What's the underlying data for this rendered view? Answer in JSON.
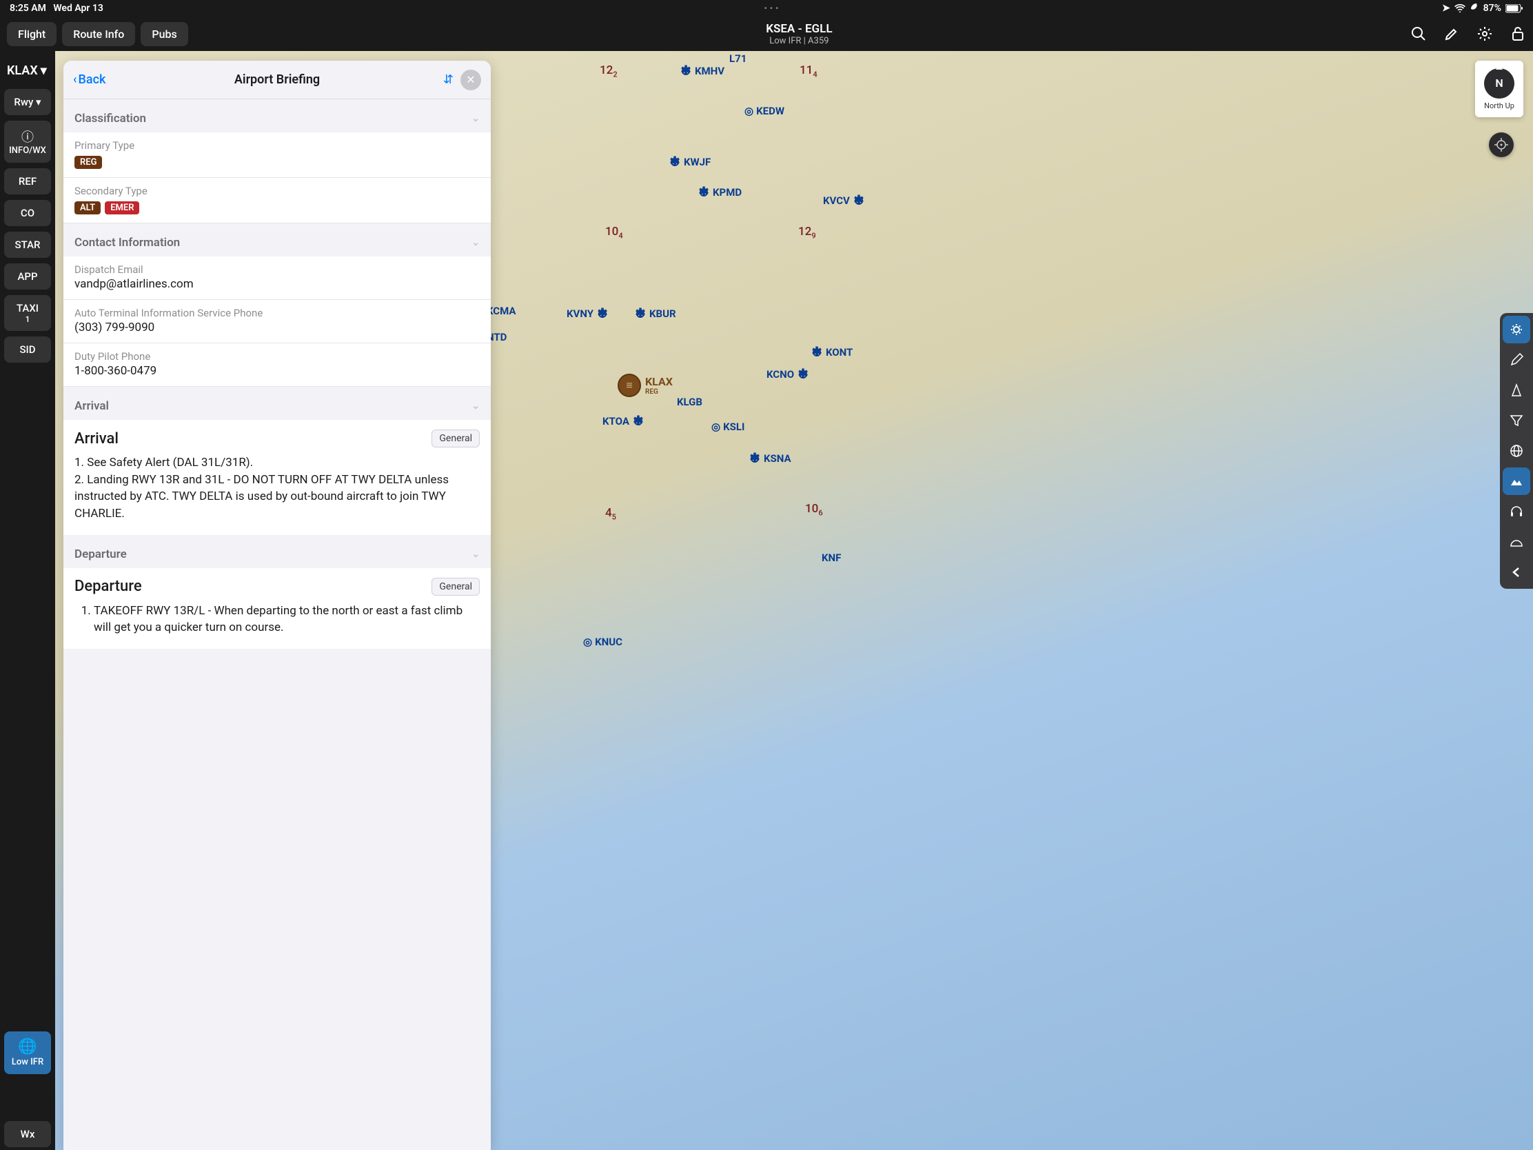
{
  "statusbar": {
    "time": "8:25 AM",
    "date": "Wed Apr 13",
    "battery": "87%"
  },
  "topbar": {
    "tabs": [
      "Flight",
      "Route Info",
      "Pubs"
    ],
    "title": "KSEA - EGLL",
    "subtitle": "Low IFR | A359"
  },
  "sidebar": {
    "airport": "KLAX",
    "buttons": [
      "Rwy",
      "INFO/WX",
      "REF",
      "CO",
      "STAR",
      "APP",
      "TAXI",
      "SID"
    ],
    "taxi_count": "1",
    "lowifr": "Low IFR",
    "wx": "Wx"
  },
  "panel": {
    "back": "Back",
    "title": "Airport Briefing",
    "sections": {
      "classification": {
        "header": "Classification",
        "primary_label": "Primary Type",
        "primary_badge": "REG",
        "secondary_label": "Secondary Type",
        "secondary_badge1": "ALT",
        "secondary_badge2": "EMER"
      },
      "contact": {
        "header": "Contact Information",
        "dispatch_label": "Dispatch Email",
        "dispatch_value": "vandp@atlairlines.com",
        "atis_label": "Auto Terminal Information Service Phone",
        "atis_value": "(303) 799-9090",
        "duty_label": "Duty Pilot Phone",
        "duty_value": "1-800-360-0479"
      },
      "arrival": {
        "header": "Arrival",
        "section_title": "Arrival",
        "tag": "General",
        "body": "1. See Safety Alert (DAL 31L/31R).\n2. Landing RWY 13R and 31L - DO NOT TURN OFF AT TWY DELTA unless instructed by ATC. TWY DELTA is used by out-bound aircraft to join TWY CHARLIE."
      },
      "departure": {
        "header": "Departure",
        "section_title": "Departure",
        "tag": "General",
        "item1": "TAKEOFF RWY 13R/L - When departing to the north or east a fast climb will get you a quicker turn on course."
      }
    }
  },
  "compass": {
    "dir": "N",
    "label": "North Up"
  },
  "map_airports": {
    "kmhv": "KMHV",
    "l71": "L71",
    "kedw": "KEDW",
    "kwjf": "KWJF",
    "kpmd": "KPMD",
    "kvcv": "KVCV",
    "kcma": "KCMA",
    "kvny": "KVNY",
    "kbur": "KBUR",
    "ntd": "NTD",
    "klax": "KLAX",
    "klax_sub": "REG",
    "klgb": "KLGB",
    "ktoa": "KTOA",
    "ksli": "KSLI",
    "kcno": "KCNO",
    "kont": "KONT",
    "ksna": "KSNA",
    "knuc": "KNUC",
    "knf": "KNF"
  },
  "map_nums": {
    "n122": "12",
    "n122s": "2",
    "n114": "11",
    "n114s": "4",
    "n104": "10",
    "n104s": "4",
    "n129": "12",
    "n129s": "9",
    "n45": "4",
    "n45s": "5",
    "n106": "10",
    "n106s": "6"
  }
}
